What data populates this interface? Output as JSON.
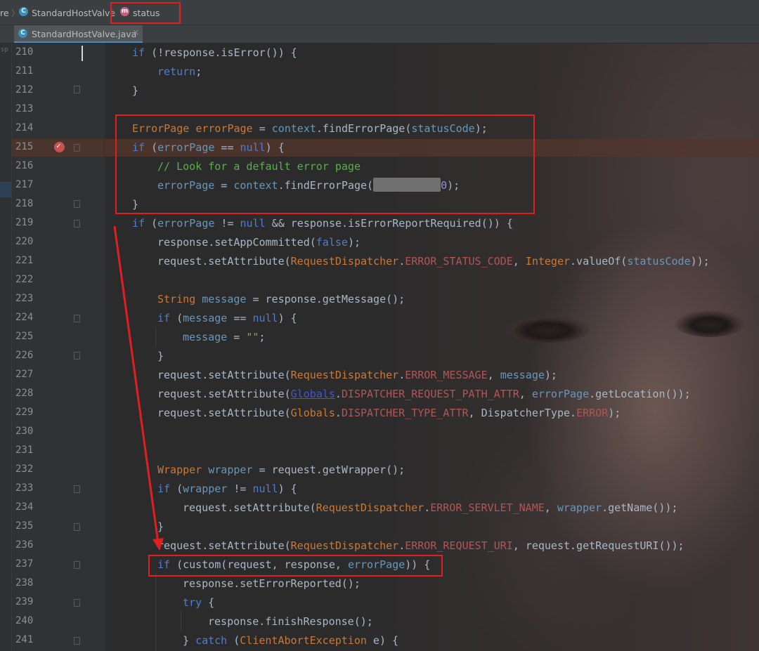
{
  "breadcrumb": {
    "items": [
      {
        "label": "re",
        "icon": "none"
      },
      {
        "label": "StandardHostValve",
        "icon": "class-icon"
      },
      {
        "label": "status",
        "icon": "method-icon"
      }
    ],
    "class_icon_letter": "C",
    "method_icon_letter": "m"
  },
  "tabs": [
    {
      "label": "StandardHostValve.java",
      "icon_letter": "C",
      "close": "×"
    }
  ],
  "left_strip_text": "sp",
  "editor": {
    "line_numbers": [
      "210",
      "211",
      "212",
      "213",
      "214",
      "215",
      "216",
      "217",
      "218",
      "219",
      "220",
      "221",
      "222",
      "223",
      "224",
      "225",
      "226",
      "227",
      "228",
      "229",
      "230",
      "231",
      "232",
      "233",
      "234",
      "235",
      "236",
      "237",
      "238",
      "239",
      "240",
      "241"
    ],
    "breakpoint_line": "215",
    "breakpoint_symbol": "✓",
    "lines": {
      "l210": {
        "t1": "if",
        "t2": " (!response.isError()) {"
      },
      "l211": {
        "t1": "return",
        "t2": ";"
      },
      "l212": {
        "t1": "}"
      },
      "l214": {
        "t1": "ErrorPage",
        "t2": " ",
        "t3": "errorPage",
        "t4": " = ",
        "t5": "context",
        "t6": ".findErrorPage(",
        "t7": "statusCode",
        "t8": ");"
      },
      "l215": {
        "t1": "if",
        "t2": " (",
        "t3": "errorPage",
        "t4": " == ",
        "t5": "null",
        "t6": ") {"
      },
      "l216": {
        "t1": "// Look for a default error page"
      },
      "l217": {
        "t1": "errorPage",
        "t2": " = ",
        "t3": "context",
        "t4": ".findErrorPage(",
        "t5": "0",
        "t6": ");"
      },
      "l218": {
        "t1": "}"
      },
      "l219": {
        "t1": "if",
        "t2": " (",
        "t3": "errorPage",
        "t4": " != ",
        "t5": "null",
        "t6": " && ",
        "t7": "response",
        "t8": ".isErrorReportRequired()) {"
      },
      "l220": {
        "t1": "response",
        "t2": ".setAppCommitted(",
        "t3": "false",
        "t4": ");"
      },
      "l221": {
        "t1": "request",
        "t2": ".setAttribute(",
        "t3": "RequestDispatcher",
        "t4": ".",
        "t5": "ERROR_STATUS_CODE",
        "t6": ", ",
        "t7": "Integer",
        "t8": ".valueOf(",
        "t9": "statusCode",
        "t10": "));"
      },
      "l223": {
        "t1": "String",
        "t2": " ",
        "t3": "message",
        "t4": " = ",
        "t5": "response",
        "t6": ".getMessage();"
      },
      "l224": {
        "t1": "if",
        "t2": " (",
        "t3": "message",
        "t4": " == ",
        "t5": "null",
        "t6": ") {"
      },
      "l225": {
        "t1": "message",
        "t2": " = ",
        "t3": "\"\"",
        "t4": ";"
      },
      "l226": {
        "t1": "}"
      },
      "l227": {
        "t1": "request",
        "t2": ".setAttribute(",
        "t3": "RequestDispatcher",
        "t4": ".",
        "t5": "ERROR_MESSAGE",
        "t6": ", ",
        "t7": "message",
        "t8": ");"
      },
      "l228": {
        "t1": "request",
        "t2": ".setAttribute(",
        "t3": "Globals",
        "t4": ".",
        "t5": "DISPATCHER_REQUEST_PATH_ATTR",
        "t6": ", ",
        "t7": "errorPage",
        "t8": ".getLocation());"
      },
      "l229": {
        "t1": "request",
        "t2": ".setAttribute(",
        "t3": "Globals",
        "t4": ".",
        "t5": "DISPATCHER_TYPE_ATTR",
        "t6": ", ",
        "t7": "DispatcherType",
        "t8": ".",
        "t9": "ERROR",
        "t10": ");"
      },
      "l232": {
        "t1": "Wrapper",
        "t2": " ",
        "t3": "wrapper",
        "t4": " = ",
        "t5": "request",
        "t6": ".getWrapper();"
      },
      "l233": {
        "t1": "if",
        "t2": " (",
        "t3": "wrapper",
        "t4": " != ",
        "t5": "null",
        "t6": ") {"
      },
      "l234": {
        "t1": "request",
        "t2": ".setAttribute(",
        "t3": "RequestDispatcher",
        "t4": ".",
        "t5": "ERROR_SERVLET_NAME",
        "t6": ", ",
        "t7": "wrapper",
        "t8": ".getName());"
      },
      "l235": {
        "t1": "}"
      },
      "l236": {
        "t1": "request",
        "t2": ".setAttribute(",
        "t3": "RequestDispatcher",
        "t4": ".",
        "t5": "ERROR_REQUEST_URI",
        "t6": ", ",
        "t7": "request",
        "t8": ".getRequestURI());"
      },
      "l237": {
        "t1": "if",
        "t2": " (custom(",
        "t3": "request",
        "t4": ", ",
        "t5": "response",
        "t6": ", ",
        "t7": "errorPage",
        "t8": ")) {"
      },
      "l238": {
        "t1": "response",
        "t2": ".setErrorReported();"
      },
      "l239": {
        "t1": "try",
        "t2": " {"
      },
      "l240": {
        "t1": "response",
        "t2": ".finishResponse();"
      },
      "l241": {
        "t1": "} ",
        "t2": "catch",
        "t3": " (",
        "t4": "ClientAbortException",
        "t5": " e) {"
      }
    }
  },
  "colors": {
    "annotation_red": "#e02020",
    "keyword": "#4f7dd0",
    "type": "#cc7832",
    "comment": "#58b048",
    "breakpoint": "#c75450"
  }
}
